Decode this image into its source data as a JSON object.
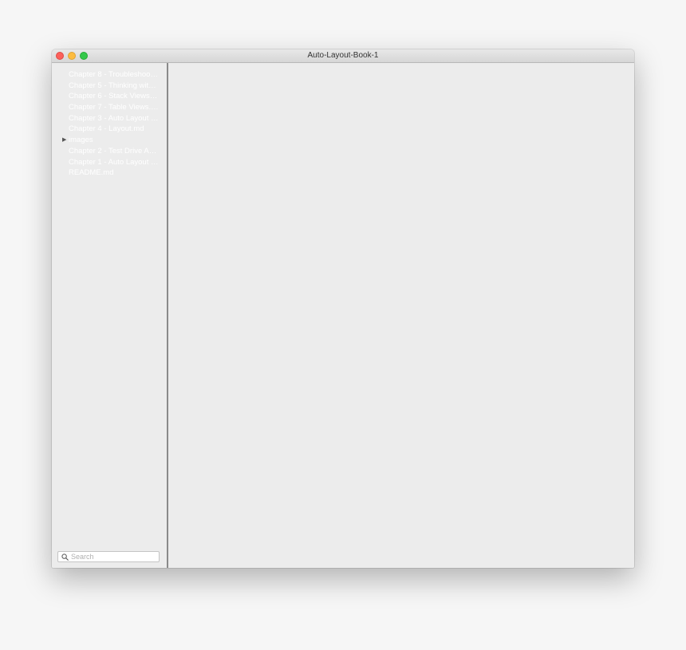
{
  "window": {
    "title": "Auto-Layout-Book-1"
  },
  "sidebar": {
    "items": [
      {
        "label": "Chapter 8 - Troubleshooting Auto Layout.md",
        "type": "file"
      },
      {
        "label": "Chapter 5 - Thinking with Auto Layout.md",
        "type": "file"
      },
      {
        "label": "Chapter 6 - Stack Views.md",
        "type": "file"
      },
      {
        "label": "Chapter 7 - Table Views.md",
        "type": "file"
      },
      {
        "label": "Chapter 3 - Auto Layout in Code.md",
        "type": "file"
      },
      {
        "label": "Chapter 4 - Layout.md",
        "type": "file"
      },
      {
        "label": "images",
        "type": "folder"
      },
      {
        "label": "Chapter 2 - Test Drive Auto Layout.md",
        "type": "file"
      },
      {
        "label": "Chapter 1 - Auto Layout Basics.md",
        "type": "file"
      },
      {
        "label": "README.md",
        "type": "file"
      }
    ],
    "search": {
      "placeholder": "Search",
      "value": ""
    }
  },
  "icons": {
    "close": "close-traffic-light",
    "minimize": "minimize-traffic-light",
    "zoom": "zoom-traffic-light",
    "disclosure": "disclosure-triangle-icon",
    "search": "magnifying-glass-icon"
  },
  "colors": {
    "close": "#fc605b",
    "minimize": "#fdbc40",
    "zoom": "#34c84a",
    "sidebar_text": "#ffffff",
    "background": "#ececec"
  }
}
